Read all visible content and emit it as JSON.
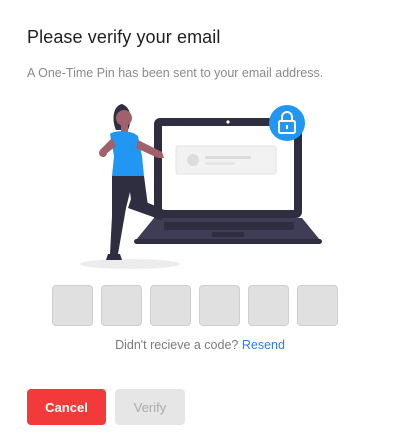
{
  "dialog": {
    "title": "Please verify your email",
    "subtitle": "A One-Time Pin has been sent to your email address."
  },
  "illustration": {
    "icons": [
      "laptop-icon",
      "lock-icon",
      "person-figure"
    ],
    "accent_color": "#2196f3"
  },
  "otp": {
    "boxes": [
      "",
      "",
      "",
      "",
      "",
      ""
    ]
  },
  "resend": {
    "prompt": "Didn't recieve a code?",
    "link_label": "Resend"
  },
  "actions": {
    "cancel_label": "Cancel",
    "verify_label": "Verify",
    "cancel_color": "#f23a3a",
    "verify_disabled": true
  }
}
